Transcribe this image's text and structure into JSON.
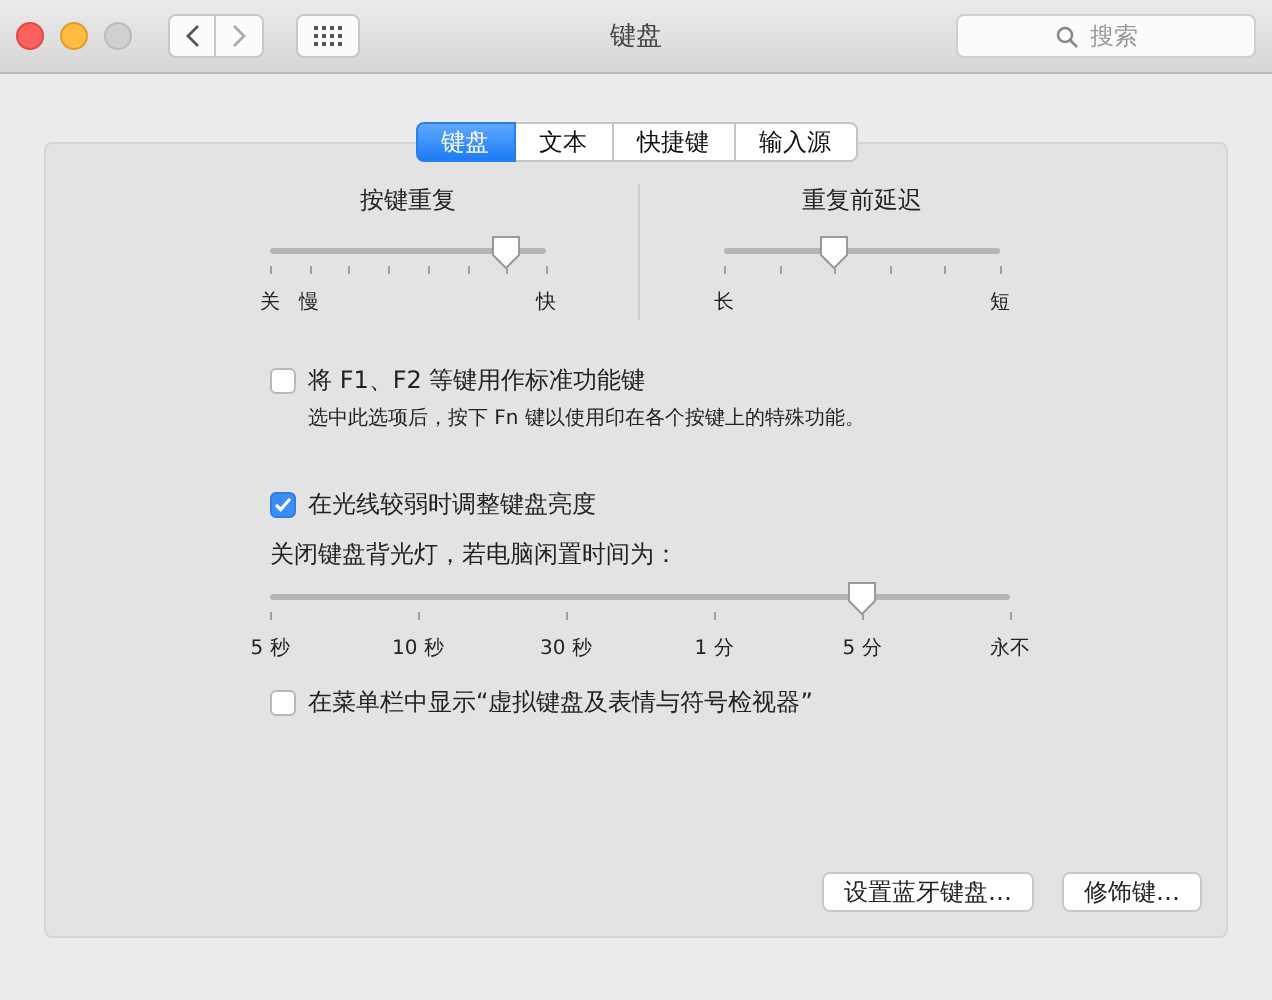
{
  "window": {
    "title": "键盘",
    "search": {
      "placeholder": "搜索"
    }
  },
  "tabs": [
    {
      "label": "键盘",
      "selected": true
    },
    {
      "label": "文本",
      "selected": false
    },
    {
      "label": "快捷键",
      "selected": false
    },
    {
      "label": "输入源",
      "selected": false
    }
  ],
  "key_repeat": {
    "title": "按键重复",
    "level": 0.857,
    "ticks": [
      {
        "kind": "labeled",
        "label": "关"
      },
      {
        "kind": "labeled",
        "label": "慢"
      },
      {
        "kind": "plain"
      },
      {
        "kind": "plain"
      },
      {
        "kind": "plain"
      },
      {
        "kind": "plain"
      },
      {
        "kind": "plain"
      },
      {
        "kind": "labeled",
        "label": "快"
      }
    ]
  },
  "delay_until_repeat": {
    "title": "重复前延迟",
    "level": 0.4,
    "ticks": [
      {
        "kind": "labeled",
        "label": "长"
      },
      {
        "kind": "plain"
      },
      {
        "kind": "plain"
      },
      {
        "kind": "plain"
      },
      {
        "kind": "plain"
      },
      {
        "kind": "labeled",
        "label": "短"
      }
    ]
  },
  "fn_keys": {
    "label": "将 F1、F2 等键用作标准功能键",
    "checked": false,
    "note": "选中此选项后，按下 Fn 键以使用印在各个按键上的特殊功能。"
  },
  "adjust_brightness": {
    "label": "在光线较弱时调整键盘亮度",
    "checked": true
  },
  "backlight_off": {
    "title": "关闭键盘背光灯，若电脑闲置时间为：",
    "level": 0.8,
    "ticks": [
      {
        "kind": "labeled",
        "label": "5 秒"
      },
      {
        "kind": "labeled",
        "label": "10 秒"
      },
      {
        "kind": "labeled",
        "label": "30 秒"
      },
      {
        "kind": "labeled",
        "label": "1 分"
      },
      {
        "kind": "labeled",
        "label": "5 分"
      },
      {
        "kind": "labeled",
        "label": "永不"
      }
    ]
  },
  "show_viewer": {
    "label": "在菜单栏中显示“虚拟键盘及表情与符号检视器”",
    "checked": false
  },
  "buttons": [
    "设置蓝牙键盘…",
    "修饰键…"
  ]
}
